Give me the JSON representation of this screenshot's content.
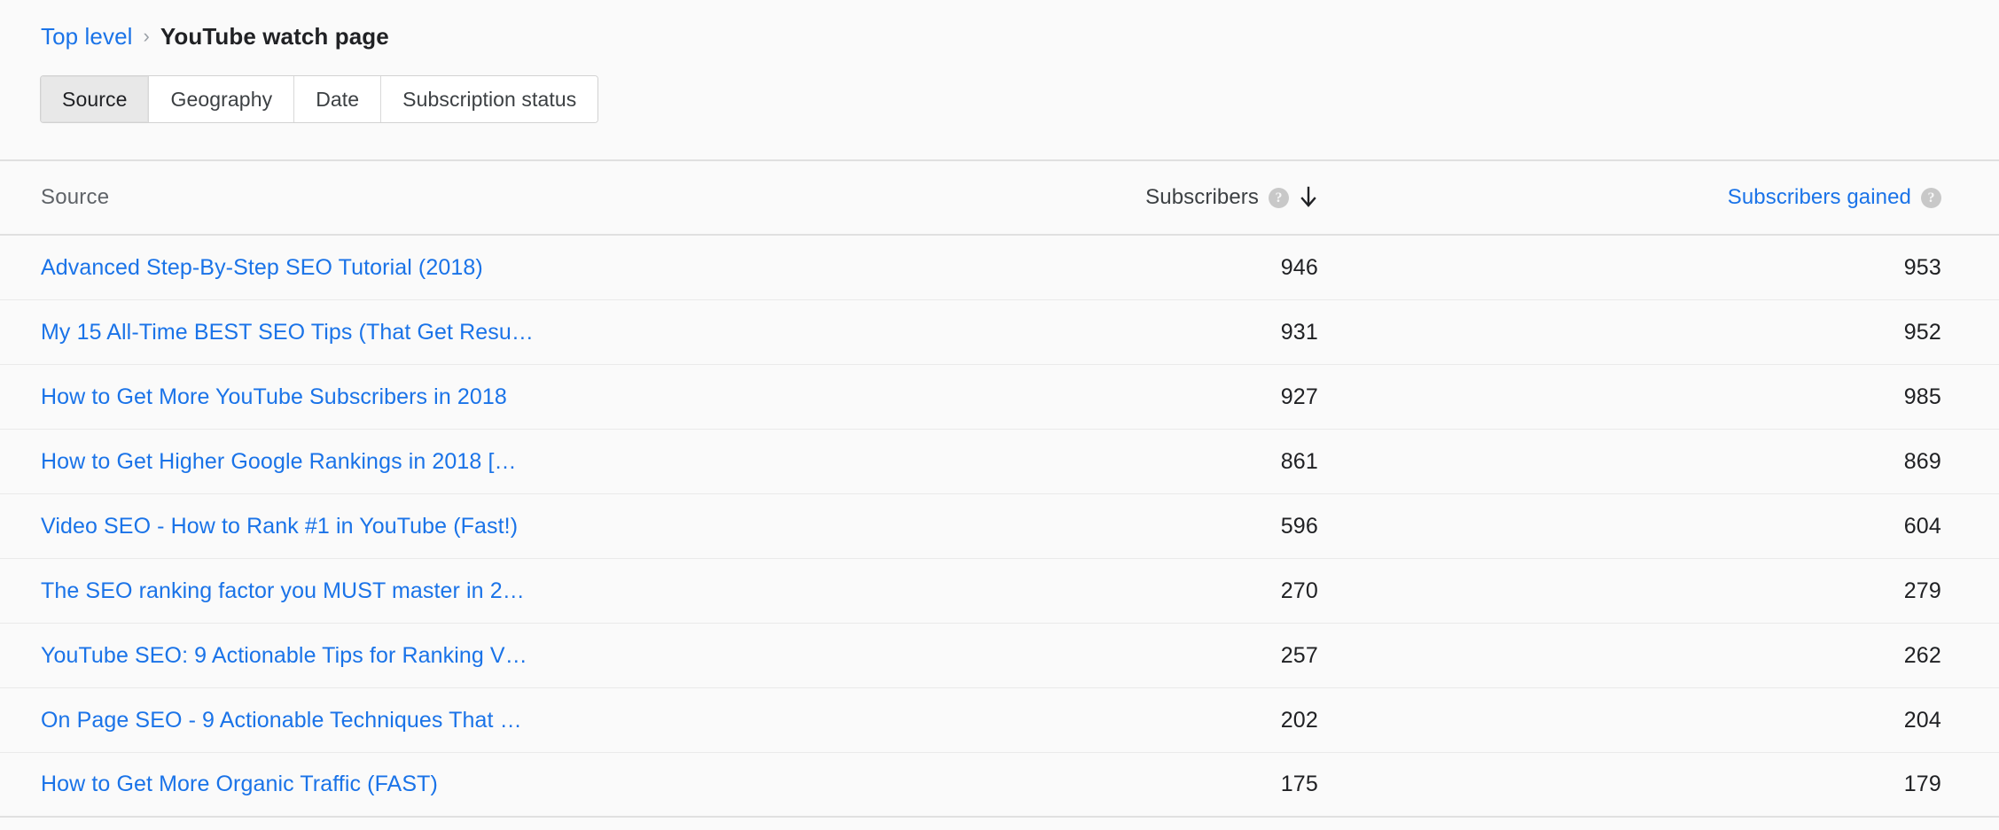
{
  "breadcrumb": {
    "root_label": "Top level",
    "separator": "›",
    "current_label": "YouTube watch page"
  },
  "tabs": [
    {
      "label": "Source",
      "selected": true
    },
    {
      "label": "Geography",
      "selected": false
    },
    {
      "label": "Date",
      "selected": false
    },
    {
      "label": "Subscription status",
      "selected": false
    }
  ],
  "table": {
    "columns": {
      "source": "Source",
      "subscribers": "Subscribers",
      "subscribers_gained": "Subscribers gained"
    },
    "sort": {
      "column": "Subscribers",
      "direction": "descending",
      "arrow_glyph": "↓"
    },
    "icons": {
      "help": "help-icon",
      "sort_desc": "sort-descending-icon"
    },
    "rows": [
      {
        "source": "Advanced Step-By-Step SEO Tutorial (2018)",
        "subscribers": "946",
        "subscribers_gained": "953"
      },
      {
        "source": "My 15 All-Time BEST SEO Tips (That Get Resu…",
        "subscribers": "931",
        "subscribers_gained": "952"
      },
      {
        "source": "How to Get More YouTube Subscribers in 2018",
        "subscribers": "927",
        "subscribers_gained": "985"
      },
      {
        "source": "How to Get Higher Google Rankings in 2018 […",
        "subscribers": "861",
        "subscribers_gained": "869"
      },
      {
        "source": "Video SEO - How to Rank #1 in YouTube (Fast!)",
        "subscribers": "596",
        "subscribers_gained": "604"
      },
      {
        "source": "The SEO ranking factor you MUST master in 2…",
        "subscribers": "270",
        "subscribers_gained": "279"
      },
      {
        "source": "YouTube SEO: 9 Actionable Tips for Ranking V…",
        "subscribers": "257",
        "subscribers_gained": "262"
      },
      {
        "source": "On Page SEO - 9 Actionable Techniques That …",
        "subscribers": "202",
        "subscribers_gained": "204"
      },
      {
        "source": "How to Get More Organic Traffic (FAST)",
        "subscribers": "175",
        "subscribers_gained": "179"
      }
    ]
  },
  "colors": {
    "link": "#1a73e8",
    "page_background": "#fafafa",
    "selected_tab_background": "#e8e8e8",
    "header_text": "#5f6368",
    "value_text": "#202124",
    "divider": "#e0e0e0"
  }
}
